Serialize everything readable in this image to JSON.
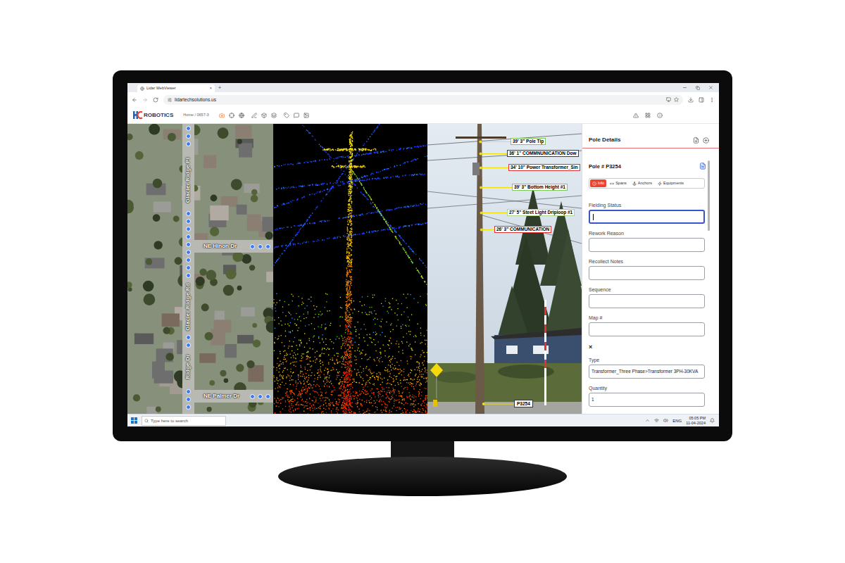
{
  "browser": {
    "tab_title": "Lidar WebViewer",
    "tab_close": "×",
    "new_tab": "+",
    "url": "lidartechsolutions.us"
  },
  "app": {
    "logo": "ROBOTICS",
    "breadcrumb": "Home / 0657-3"
  },
  "map": {
    "roads": [
      {
        "label": "NE Hinon Dr",
        "kind": "horizontal"
      },
      {
        "label": "NE Palmer Dr",
        "kind": "horizontal"
      },
      {
        "label": "Glacier Ridge Pl",
        "kind": "vertical"
      },
      {
        "label": "Glacier Ridge Rd",
        "kind": "vertical"
      },
      {
        "label": "Ridge Dr",
        "kind": "vertical"
      }
    ]
  },
  "photo": {
    "labels": [
      {
        "text": "39' 3\" Pole Tip",
        "color": "#7cc95a"
      },
      {
        "text": "36' 1'' COMMNUNICATION Dow",
        "color": "#3a3a3a"
      },
      {
        "text": "34' 10\" Power Transformer_Sin",
        "color": "#e03131"
      },
      {
        "text": "39' 3\" Bottom Height #1",
        "color": "#7cc95a"
      },
      {
        "text": "27' 5\" Steet Light Driploop #1",
        "color": "#a8d98a"
      },
      {
        "text": "26' 3\" COMMUNICATION",
        "color": "#e03131"
      }
    ],
    "pole_tag": "P3254"
  },
  "panel": {
    "title": "Pole Details",
    "pole": "Pole # P3254",
    "tabs": [
      {
        "label": "Info",
        "selected": true
      },
      {
        "label": "Spans",
        "selected": false
      },
      {
        "label": "Anchors",
        "selected": false
      },
      {
        "label": "Equipments",
        "selected": false
      }
    ],
    "fields": [
      {
        "label": "Fielding Status",
        "value": "",
        "focused": true
      },
      {
        "label": "Rework Reason",
        "value": "",
        "focused": false
      },
      {
        "label": "Recollect Notes",
        "value": "",
        "focused": false
      },
      {
        "label": "Sequence",
        "value": "",
        "focused": false
      },
      {
        "label": "Map #",
        "value": "",
        "focused": false
      }
    ],
    "equipment": {
      "remove": "×",
      "fields": [
        {
          "label": "Type",
          "value": "Transformer_Three Phase>Transformer 3PH-30KVA",
          "focused": false
        },
        {
          "label": "Quantity",
          "value": "1",
          "focused": false
        }
      ]
    }
  },
  "taskbar": {
    "search_placeholder": "Type here to search",
    "language": "ENG",
    "time": "05:05 PM",
    "date": "11-04-2024"
  }
}
